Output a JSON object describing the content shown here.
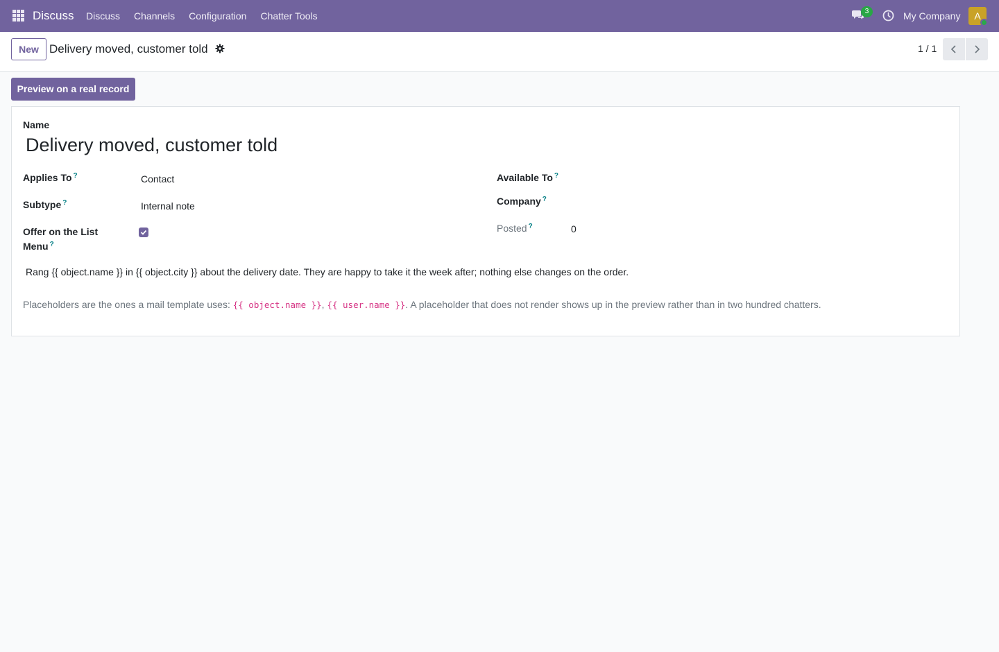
{
  "navbar": {
    "brand": "Discuss",
    "menu": [
      "Discuss",
      "Channels",
      "Configuration",
      "Chatter Tools"
    ],
    "chat_count": "3",
    "company": "My Company",
    "avatar_letter": "A",
    "bg_color": "#71639e"
  },
  "control": {
    "new_label": "New",
    "title": "Delivery moved, customer told",
    "pager": "1 / 1"
  },
  "actions": {
    "preview_label": "Preview on a real record"
  },
  "form": {
    "name_label": "Name",
    "name_value": "Delivery moved, customer told",
    "applies_to_label": "Applies To",
    "applies_to_value": "Contact",
    "subtype_label": "Subtype",
    "subtype_value": "Internal note",
    "offer_label_1": "Offer on the List",
    "offer_label_2": "Menu",
    "offer_checked": true,
    "available_to_label": "Available To",
    "company_label": "Company",
    "posted_label": "Posted",
    "posted_value": "0",
    "help_mark": "?",
    "body": "Rang {{ object.name }} in {{ object.city }} about the delivery date. They are happy to take it the week after; nothing else changes on the order.",
    "hint_prefix": "Placeholders are the ones a mail template uses: ",
    "hint_code_1": "{{ object.name }}",
    "hint_sep": ", ",
    "hint_code_2": "{{ user.name }}",
    "hint_suffix": ". A placeholder that does not render shows up in the preview rather than in two hundred chatters."
  }
}
